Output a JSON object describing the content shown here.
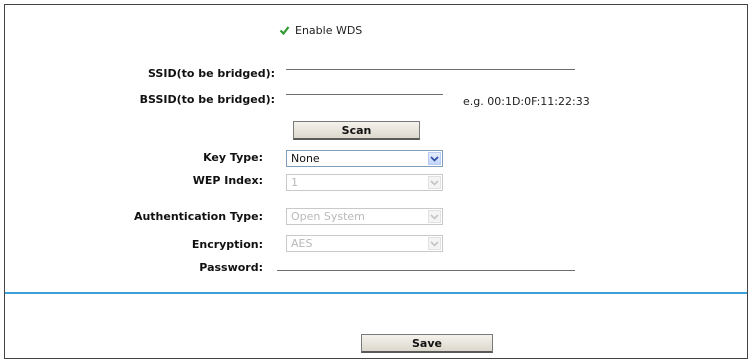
{
  "wds": {
    "enable_label": "Enable WDS",
    "enabled": true
  },
  "form": {
    "ssid_label": "SSID(to be bridged):",
    "ssid_value": "",
    "bssid_label": "BSSID(to be bridged):",
    "bssid_value": "",
    "bssid_hint": "e.g. 00:1D:0F:11:22:33",
    "scan_label": "Scan",
    "key_type_label": "Key Type:",
    "key_type_value": "None",
    "wep_index_label": "WEP Index:",
    "wep_index_value": "1",
    "auth_type_label": "Authentication Type:",
    "auth_type_value": "Open System",
    "encryption_label": "Encryption:",
    "encryption_value": "AES",
    "password_label": "Password:",
    "password_value": ""
  },
  "footer": {
    "save_label": "Save"
  },
  "colors": {
    "divider": "#3c9fd8",
    "checkbox_mark": "#2f9a2f",
    "select_border": "#7f9db9",
    "select_arrow": "#2b4ea3"
  }
}
